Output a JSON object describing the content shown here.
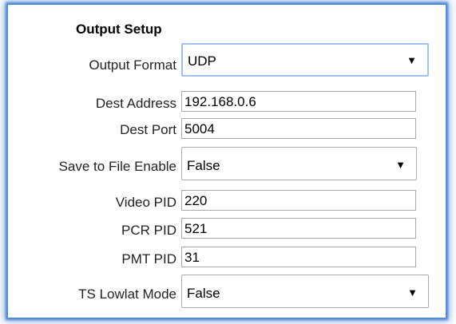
{
  "section_title": "Output Setup",
  "fields": {
    "output_format": {
      "label": "Output Format",
      "value": "UDP"
    },
    "dest_address": {
      "label": "Dest Address",
      "value": "192.168.0.6"
    },
    "dest_port": {
      "label": "Dest Port",
      "value": "5004"
    },
    "save_to_file_enable": {
      "label": "Save to File Enable",
      "value": "False"
    },
    "video_pid": {
      "label": "Video PID",
      "value": "220"
    },
    "pcr_pid": {
      "label": "PCR PID",
      "value": "521"
    },
    "pmt_pid": {
      "label": "PMT PID",
      "value": "31"
    },
    "ts_lowlat_mode": {
      "label": "TS Lowlat Mode",
      "value": "False"
    }
  },
  "icons": {
    "dropdown": "dropdown-arrow-icon"
  }
}
